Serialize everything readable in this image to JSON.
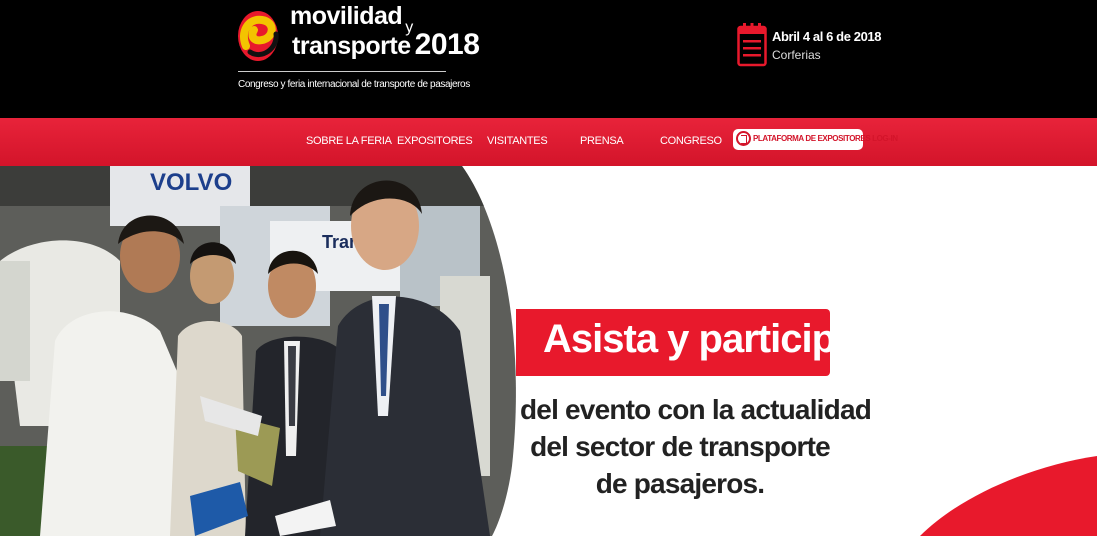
{
  "header": {
    "brand_line1": "movilidad",
    "brand_y": "y",
    "brand_line2": "transporte",
    "brand_year": "2018",
    "tagline": "Congreso y feria internacional de transporte de pasajeros",
    "date_main": "Abril 4 al 6 de 2018",
    "date_venue": "Corferias",
    "icons": {
      "logo": "movilidad-logo",
      "calendar": "calendar-icon"
    }
  },
  "nav": {
    "items": [
      "SOBRE LA FERIA",
      "EXPOSITORES",
      "VISITANTES",
      "PRENSA",
      "CONGRESO"
    ],
    "login_label": "PLATAFORMA DE EXPOSITORES LOG-IN",
    "login_icon": "login-icon"
  },
  "hero": {
    "title": "Asista y participe",
    "subtitle_lines": [
      "del evento con la actualidad",
      "del sector de transporte",
      "de pasajeros."
    ],
    "photo_text": [
      "VOLVO",
      "Transm"
    ]
  },
  "colors": {
    "header_bg": "#000000",
    "nav_red": "#d3142a",
    "accent_red": "#e8192c",
    "text_dark": "#222222"
  }
}
